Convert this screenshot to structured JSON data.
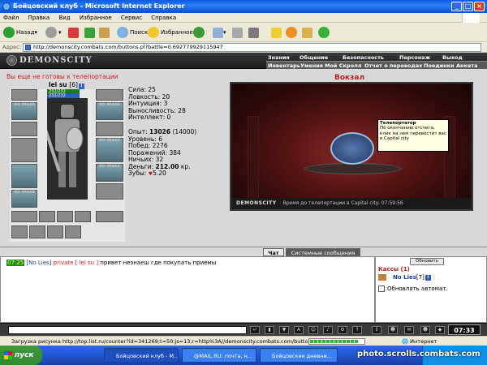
{
  "window": {
    "title": "Бойцовский клуб - Microsoft Internet Explorer"
  },
  "menubar": {
    "items": [
      "Файл",
      "Правка",
      "Вид",
      "Избранное",
      "Сервис",
      "Справка"
    ]
  },
  "toolbar": {
    "back_label": "Назад",
    "search_label": "Поиск",
    "favorites_label": "Избранное"
  },
  "address": {
    "label": "Адрес:",
    "url": "http://demonscity.combats.com/buttons.pl?battle=0.692779929115947"
  },
  "game_header": {
    "logo": "DEMONSCITY",
    "top_menu": [
      "Знания",
      "Общение",
      "Безопасность",
      "Персонаж",
      "Выход"
    ],
    "sub_menu": [
      "Инвентарь",
      "Умения",
      "Мой Скролл",
      "Отчет о переводах",
      "Поединки",
      "Анкета"
    ]
  },
  "character": {
    "warning": "Вы еще не готовы к телепортации",
    "name": "lei su",
    "level": "[6]",
    "hp": "232/232",
    "mp": "232/232",
    "slot_label": "NO IMAGE",
    "stats": [
      "Сила: 25",
      "Ловкость: 20",
      "Интуиция: 3",
      "Выносливость: 28",
      "Интеллект: 0"
    ],
    "exp_label": "Опыт:",
    "exp_value": "13026",
    "exp_next": "(14000)",
    "level_label": "Уровень: 6",
    "wins": "Побед: 2276",
    "losses": "Поражений: 384",
    "draws": "Ничьих: 32",
    "money_label": "Деньги:",
    "money_value": "212.00",
    "money_unit": "кр.",
    "teeth_label": "Зубы:",
    "teeth_value": "5.20"
  },
  "location": {
    "title": "Вокзал",
    "tooltip_title": "Телепортатор",
    "tooltip_text": "По окончанию отсчета, клик на нем перевестит вас в Capital city",
    "footer_brand": "DEMONSCITY",
    "footer_text": "Время до телепортации в Capital city: 07:59:56"
  },
  "chat": {
    "tabs": [
      "Чат",
      "Системные сообщения"
    ],
    "line": {
      "time": "07:25",
      "nick": "[No Lies]",
      "private": "private [ lei su ]",
      "text": "привет незнаеш где покупать приемы"
    }
  },
  "side_panel": {
    "refresh_label": "Обновить",
    "kassy": "Кассы (1)",
    "user": "No Lies",
    "user_level": "[7]",
    "auto_label": "Обновлять автомат."
  },
  "chat_bar": {
    "clock": "07:33"
  },
  "statusbar": {
    "text": "Загрузка рисунка http://top.list.ru/counter?id=341269;t=50;js=13;r=http%3A//demonscity.combats.com/buttons.pl%3Fb",
    "zone": "Интернет"
  },
  "taskbar": {
    "start": "пуск",
    "tasks": [
      "Бойцовский клуб - M...",
      "@MAIL.RU: почта, н...",
      "Бойцовские дневни..."
    ]
  },
  "watermark": "photo.scrolls.combats.com"
}
